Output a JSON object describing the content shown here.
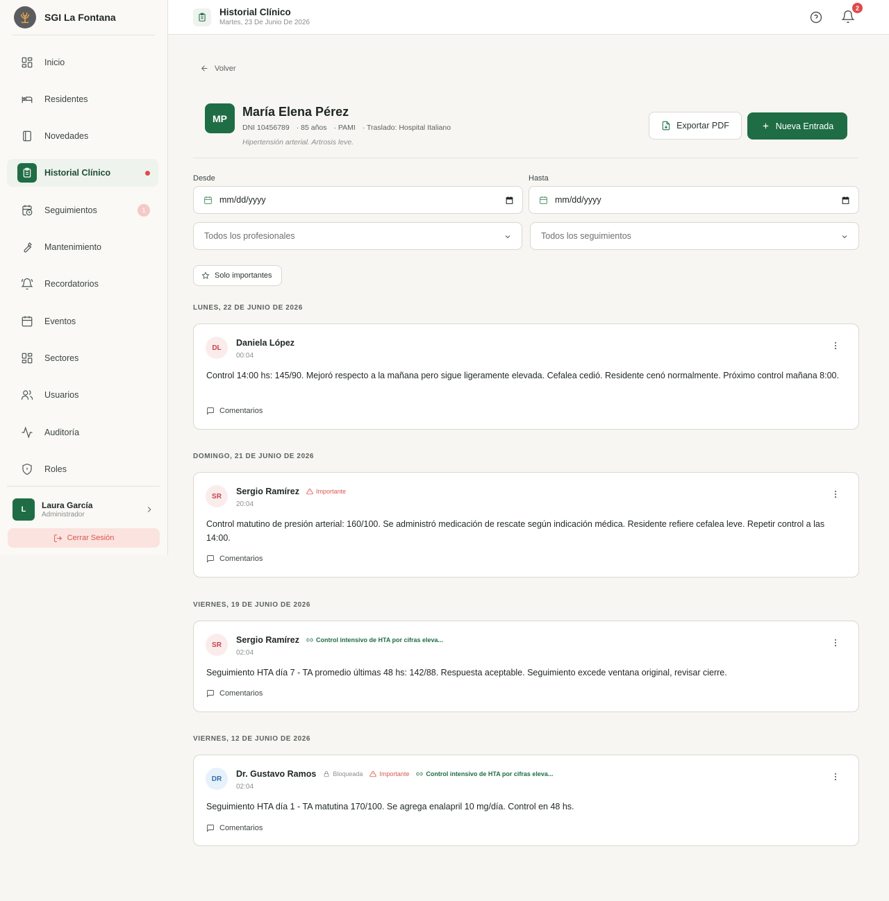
{
  "brand": {
    "name": "SGI La Fontana"
  },
  "sidebar": {
    "items": [
      {
        "label": "Inicio",
        "icon": "grid-icon"
      },
      {
        "label": "Residentes",
        "icon": "bed-icon"
      },
      {
        "label": "Novedades",
        "icon": "book-icon"
      },
      {
        "label": "Historial Clínico",
        "icon": "clipboard-icon"
      },
      {
        "label": "Seguimientos",
        "icon": "calendar-clock-icon",
        "badge": "1"
      },
      {
        "label": "Mantenimiento",
        "icon": "wrench-icon"
      },
      {
        "label": "Recordatorios",
        "icon": "bell-ring-icon"
      },
      {
        "label": "Eventos",
        "icon": "calendar-icon"
      },
      {
        "label": "Sectores",
        "icon": "grid-icon"
      },
      {
        "label": "Usuarios",
        "icon": "users-icon"
      },
      {
        "label": "Auditoría",
        "icon": "activity-icon"
      },
      {
        "label": "Roles",
        "icon": "shield-icon"
      }
    ],
    "user": {
      "initial": "L",
      "name": "Laura García",
      "role": "Administrador"
    },
    "logout_label": "Cerrar Sesión"
  },
  "header": {
    "title": "Historial Clínico",
    "date": "Martes, 23 De Junio De 2026",
    "notifications": "2"
  },
  "main": {
    "back_label": "Volver",
    "patient": {
      "initials": "MP",
      "name": "María Elena Pérez",
      "dni": "DNI 10456789",
      "age": "· 85 años",
      "coverage": "· PAMI",
      "transfer": "· Traslado: Hospital Italiano",
      "diagnosis": "Hipertensión arterial. Artrosis leve."
    },
    "export_label": "Exportar PDF",
    "new_entry_label": "Nueva Entrada",
    "filters": {
      "from_label": "Desde",
      "to_label": "Hasta",
      "date_placeholder": "mm/dd/yyyy",
      "professionals": "Todos los profesionales",
      "followups": "Todos los seguimientos",
      "important_only": "Solo importantes"
    },
    "comments_label": "Comentarios",
    "entries": [
      {
        "day": "LUNES, 22 DE JUNIO DE 2026",
        "initials": "DL",
        "author": "Daniela López",
        "time": "00:04",
        "text": "Control 14:00 hs: 145/90. Mejoró respecto a la mañana pero sigue ligeramente elevada. Cefalea cedió. Residente cenó normalmente. Próximo control mañana 8:00."
      },
      {
        "day": "DOMINGO, 21 DE JUNIO DE 2026",
        "initials": "SR",
        "author": "Sergio Ramírez",
        "important": "Importante",
        "time": "20:04",
        "text": "Control matutino de presión arterial: 160/100. Se administró medicación de rescate según indicación médica. Residente refiere cefalea leve. Repetir control a las 14:00."
      },
      {
        "day": "VIERNES, 19 DE JUNIO DE 2026",
        "initials": "SR",
        "author": "Sergio Ramírez",
        "linked": "Control intensivo de HTA por cifras eleva...",
        "time": "02:04",
        "text": "Seguimiento HTA día 7 - TA promedio últimas 48 hs: 142/88. Respuesta aceptable. Seguimiento excede ventana original, revisar cierre."
      },
      {
        "day": "VIERNES, 12 DE JUNIO DE 2026",
        "initials": "DR",
        "author": "Dr. Gustavo Ramos",
        "locked": "Bloqueada",
        "important": "Importante",
        "linked": "Control intensivo de HTA por cifras eleva...",
        "time": "02:04",
        "text": "Seguimiento HTA día 1 - TA matutina 170/100. Se agrega enalapril 10 mg/día. Control en 48 hs."
      }
    ]
  }
}
